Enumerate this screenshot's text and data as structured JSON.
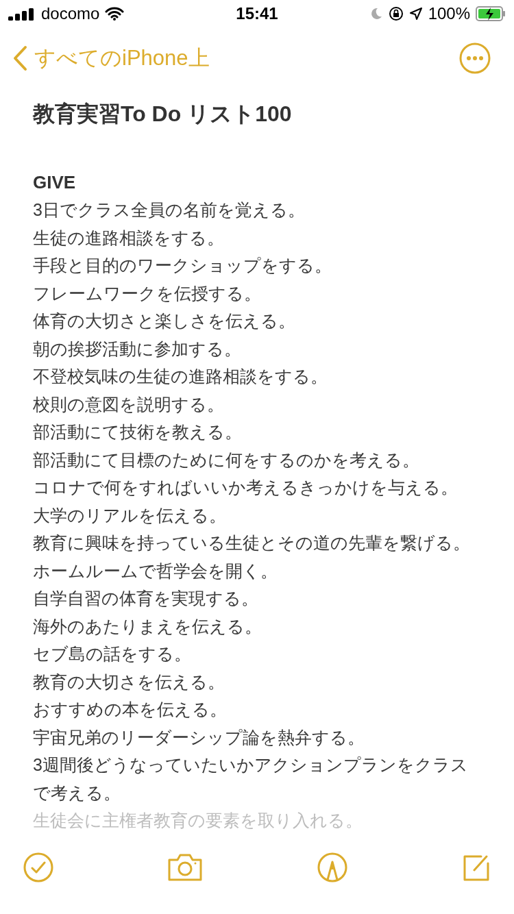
{
  "status_bar": {
    "carrier": "docomo",
    "time": "15:41",
    "battery": "100%"
  },
  "nav": {
    "back": "すべてのiPhone上"
  },
  "note": {
    "title": "教育実習To Do リスト100",
    "heading": "GIVE",
    "lines": [
      "3日でクラス全員の名前を覚える。",
      "生徒の進路相談をする。",
      "手段と目的のワークショップをする。",
      "フレームワークを伝授する。",
      "体育の大切さと楽しさを伝える。",
      "朝の挨拶活動に参加する。",
      "不登校気味の生徒の進路相談をする。",
      "校則の意図を説明する。",
      "部活動にて技術を教える。",
      "部活動にて目標のために何をするのかを考える。",
      "コロナで何をすればいいか考えるきっかけを与える。",
      "大学のリアルを伝える。",
      "教育に興味を持っている生徒とその道の先輩を繋げる。",
      "ホームルームで哲学会を開く。",
      "自学自習の体育を実現する。",
      "海外のあたりまえを伝える。",
      "セブ島の話をする。",
      "教育の大切さを伝える。",
      "おすすめの本を伝える。",
      "宇宙兄弟のリーダーシップ論を熱弁する。",
      "3週間後どうなっていたいかアクションプランをクラスで考える。"
    ],
    "faded_lines": [
      "生徒会に主権者教育の要素を取り入れる。"
    ]
  }
}
